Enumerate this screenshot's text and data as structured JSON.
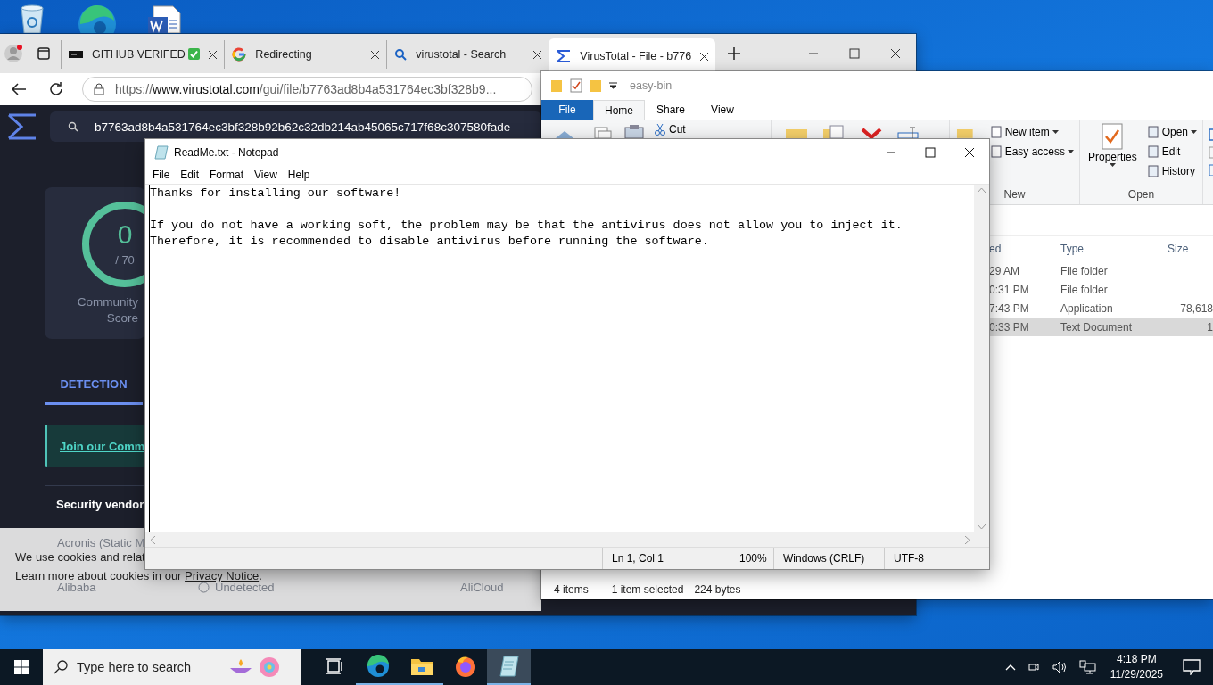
{
  "desktop": {
    "icons": [
      {
        "kind": "recycle_bin"
      },
      {
        "kind": "edge"
      },
      {
        "kind": "word"
      }
    ]
  },
  "browser": {
    "tabs": [
      {
        "title": "GITHUB VERIFED",
        "kind": "terminal",
        "verified": true,
        "selected": false
      },
      {
        "title": "Redirecting",
        "kind": "google",
        "verified": false,
        "selected": false
      },
      {
        "title": "virustotal - Search",
        "kind": "search",
        "verified": false,
        "selected": false
      },
      {
        "title": "VirusTotal - File - b776",
        "kind": "virustotal",
        "verified": false,
        "selected": true
      }
    ],
    "url": {
      "scheme": "https://",
      "host": "www.virustotal.com",
      "path": "/gui/file/b7763ad8b4a531764ec3bf328b9..."
    },
    "search_value": "b7763ad8b4a531764ec3bf328b92b62c32db214ab45065c717f68c307580fade",
    "score": {
      "value": "0",
      "total": "/ 70",
      "label": "Community Score"
    },
    "page_tabs": [
      {
        "label": "DETECTION",
        "selected": true
      }
    ],
    "notice_link": "Join our Comm",
    "section_title": "Security vendor",
    "vendor_rows": [
      {
        "cells": [
          "Acronis (Static M"
        ]
      },
      {
        "cells": [
          "Alibaba",
          "Undetected",
          "AliCloud"
        ]
      }
    ],
    "cookie": {
      "line1": "We use cookies and relat",
      "line2": "Learn more about cookies in our ",
      "link": "Privacy Notice",
      "line2_end": "."
    }
  },
  "explorer": {
    "title": "easy-bin",
    "ribbon_tabs": [
      {
        "label": "File",
        "kind": "menu",
        "selected": false
      },
      {
        "label": "Home",
        "kind": "tab",
        "selected": true
      },
      {
        "label": "Share",
        "kind": "tab",
        "selected": false
      },
      {
        "label": "View",
        "kind": "tab",
        "selected": false
      }
    ],
    "cut": "Cut",
    "new_group": {
      "label": "New",
      "items": [
        {
          "label": "New item",
          "dropdown": true
        },
        {
          "label": "Easy access",
          "dropdown": true
        }
      ]
    },
    "open_group": {
      "label": "Open",
      "properties": "Properties",
      "items": [
        {
          "label": "Open",
          "dropdown": true
        },
        {
          "label": "Edit",
          "dropdown": false
        },
        {
          "label": "History",
          "dropdown": false
        }
      ]
    },
    "columns": [
      "ed",
      "Type",
      "Size"
    ],
    "files": [
      {
        "modified": "29 AM",
        "type": "File folder",
        "selected": false
      },
      {
        "modified": "0:31 PM",
        "type": "File folder",
        "selected": false
      },
      {
        "modified": "7:43 PM",
        "type": "Application",
        "size": "78,618",
        "selected": false
      },
      {
        "modified": "0:33 PM",
        "type": "Text Document",
        "size": "1",
        "selected": true
      }
    ],
    "status": {
      "count": "4 items",
      "selection": "1 item selected",
      "size": "224 bytes"
    }
  },
  "notepad": {
    "title": "ReadMe.txt - Notepad",
    "menu": [
      "File",
      "Edit",
      "Format",
      "View",
      "Help"
    ],
    "paragraphs": [
      [
        "Thanks for installing our software!"
      ],
      [
        "If you do not have a working soft, the problem may be that the antivirus does not allow you to inject it.",
        "Therefore, it is recommended to disable antivirus before running the software."
      ]
    ],
    "status": [
      "Ln 1, Col 1",
      "100%",
      "Windows (CRLF)",
      "UTF-8"
    ]
  },
  "taskbar": {
    "search_placeholder": "Type here to search",
    "apps": [
      {
        "kind": "task_view",
        "running": false,
        "selected": false
      },
      {
        "kind": "edge",
        "running": true,
        "selected": false
      },
      {
        "kind": "explorer",
        "running": true,
        "selected": false
      },
      {
        "kind": "firefox",
        "running": false,
        "selected": false
      },
      {
        "kind": "notepad",
        "running": true,
        "selected": true
      }
    ],
    "time": "4:18 PM",
    "date": "11/29/2025"
  }
}
